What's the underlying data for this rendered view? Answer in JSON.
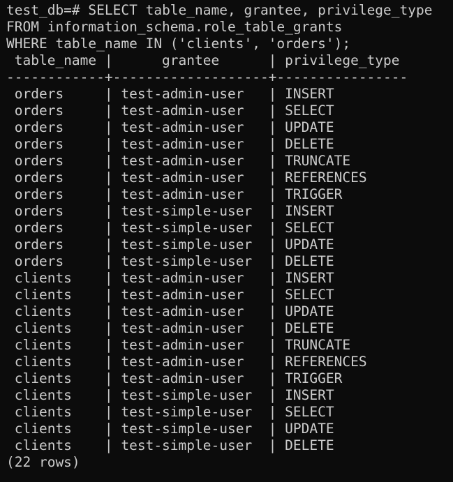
{
  "terminal": {
    "prompt": "test_db=# ",
    "query_lines": [
      "SELECT table_name, grantee, privilege_type",
      "FROM information_schema.role_table_grants",
      "WHERE table_name IN ('clients', 'orders');"
    ],
    "header_line": " table_name |      grantee      | privilege_type",
    "separator_line": "------------+-------------------+----------------",
    "rows": [
      " orders     | test-admin-user   | INSERT",
      " orders     | test-admin-user   | SELECT",
      " orders     | test-admin-user   | UPDATE",
      " orders     | test-admin-user   | DELETE",
      " orders     | test-admin-user   | TRUNCATE",
      " orders     | test-admin-user   | REFERENCES",
      " orders     | test-admin-user   | TRIGGER",
      " orders     | test-simple-user  | INSERT",
      " orders     | test-simple-user  | SELECT",
      " orders     | test-simple-user  | UPDATE",
      " orders     | test-simple-user  | DELETE",
      " clients    | test-admin-user   | INSERT",
      " clients    | test-admin-user   | SELECT",
      " clients    | test-admin-user   | UPDATE",
      " clients    | test-admin-user   | DELETE",
      " clients    | test-admin-user   | TRUNCATE",
      " clients    | test-admin-user   | REFERENCES",
      " clients    | test-admin-user   | TRIGGER",
      " clients    | test-simple-user  | INSERT",
      " clients    | test-simple-user  | SELECT",
      " clients    | test-simple-user  | UPDATE",
      " clients    | test-simple-user  | DELETE"
    ],
    "footer": "(22 rows)",
    "colors": {
      "background": "#0c0c0c",
      "text": "#cccccc"
    }
  }
}
